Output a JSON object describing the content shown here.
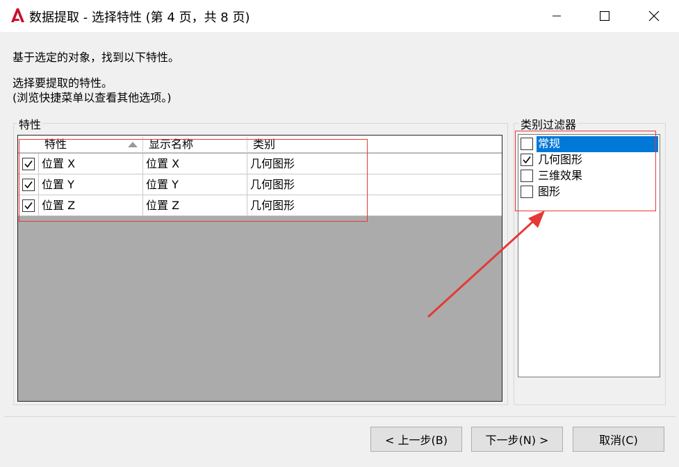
{
  "window": {
    "title": "数据提取 - 选择特性 (第 4 页，共 8 页)",
    "app_icon": "autocad-a-icon",
    "controls": [
      "minimize-icon",
      "maximize-icon",
      "close-icon"
    ]
  },
  "instructions": {
    "line1": "基于选定的对象，找到以下特性。",
    "line2": "选择要提取的特性。",
    "line3": "(浏览快捷菜单以查看其他选项。)"
  },
  "properties_group": {
    "label": "特性",
    "columns": [
      "特性",
      "显示名称",
      "类别"
    ],
    "sort_indicator": "sort-ascending-icon",
    "rows": [
      {
        "checked": true,
        "property": "位置 X",
        "display_name": "位置 X",
        "category": "几何图形"
      },
      {
        "checked": true,
        "property": "位置 Y",
        "display_name": "位置 Y",
        "category": "几何图形"
      },
      {
        "checked": true,
        "property": "位置 Z",
        "display_name": "位置 Z",
        "category": "几何图形"
      }
    ]
  },
  "filter_group": {
    "label": "类别过滤器",
    "items": [
      {
        "label": "常规",
        "checked": false,
        "selected": true
      },
      {
        "label": "几何图形",
        "checked": true,
        "selected": false
      },
      {
        "label": "三维效果",
        "checked": false,
        "selected": false
      },
      {
        "label": "图形",
        "checked": false,
        "selected": false
      }
    ]
  },
  "buttons": {
    "back": "< 上一步(B)",
    "next": "下一步(N) >",
    "cancel": "取消(C)"
  },
  "colors": {
    "selection": "#0078d7",
    "annotation": "#e53935",
    "grid_empty": "#ababab"
  }
}
